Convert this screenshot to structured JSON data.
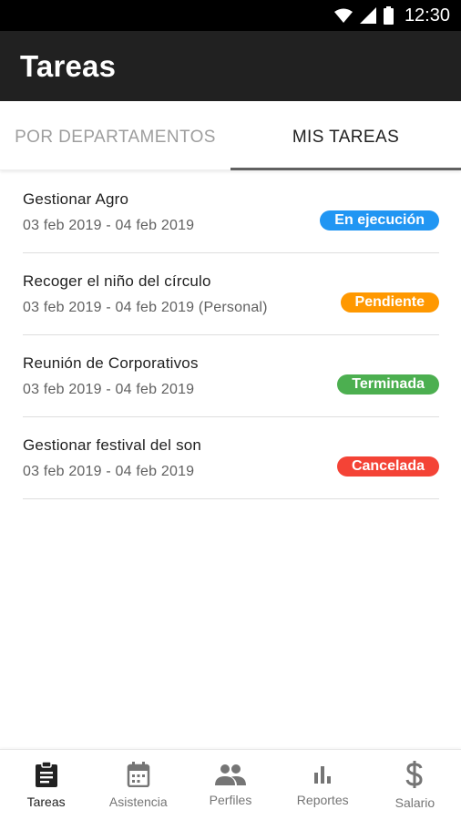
{
  "status_bar": {
    "time": "12:30",
    "icons": [
      "wifi-icon",
      "signal-icon",
      "battery-icon"
    ]
  },
  "app_bar": {
    "title": "Tareas"
  },
  "tabs": [
    {
      "label": "POR DEPARTAMENTOS",
      "active": false
    },
    {
      "label": "MIS TAREAS",
      "active": true
    }
  ],
  "tasks": [
    {
      "name": "Gestionar Agro",
      "dates": "03 feb 2019 - 04 feb 2019",
      "status": "En ejecución",
      "status_color": "#2196f3"
    },
    {
      "name": "Recoger el niño del círculo",
      "dates": "03 feb 2019 - 04 feb 2019 (Personal)",
      "status": "Pendiente",
      "status_color": "#ff9800"
    },
    {
      "name": "Reunión de Corporativos",
      "dates": "03 feb 2019 - 04 feb 2019",
      "status": "Terminada",
      "status_color": "#4caf50"
    },
    {
      "name": "Gestionar festival del son",
      "dates": "03 feb 2019 - 04 feb 2019",
      "status": "Cancelada",
      "status_color": "#f44336"
    }
  ],
  "bottom_nav": [
    {
      "label": "Tareas",
      "icon": "clipboard-icon",
      "active": true
    },
    {
      "label": "Asistencia",
      "icon": "calendar-icon",
      "active": false
    },
    {
      "label": "Perfiles",
      "icon": "people-icon",
      "active": false
    },
    {
      "label": "Reportes",
      "icon": "bar-chart-icon",
      "active": false
    },
    {
      "label": "Salario",
      "icon": "dollar-icon",
      "active": false
    }
  ],
  "colors": {
    "app_bar": "#212121",
    "status_bar": "#000000",
    "tab_indicator": "#616161"
  }
}
